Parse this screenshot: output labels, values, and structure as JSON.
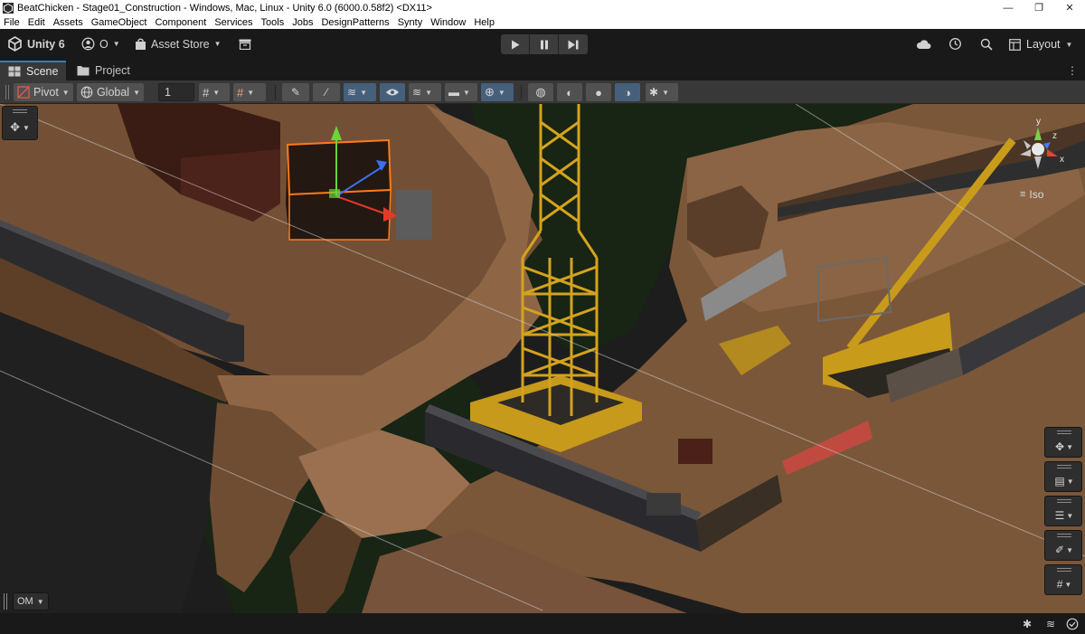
{
  "window": {
    "title": "BeatChicken - Stage01_Construction - Windows, Mac, Linux - Unity 6.0 (6000.0.58f2) <DX11>",
    "minimize": "—",
    "maximize": "❐",
    "close": "✕"
  },
  "menu": [
    "File",
    "Edit",
    "Assets",
    "GameObject",
    "Component",
    "Services",
    "Tools",
    "Jobs",
    "DesignPatterns",
    "Synty",
    "Window",
    "Help"
  ],
  "toolbar": {
    "product": "Unity 6",
    "account": "O",
    "asset_store": "Asset Store",
    "layout": "Layout"
  },
  "tabs": [
    {
      "label": "Scene",
      "active": true
    },
    {
      "label": "Project",
      "active": false
    }
  ],
  "scene_toolbar": {
    "pivot": "Pivot",
    "global": "Global",
    "grid_snap_value": "1"
  },
  "scene_view": {
    "projection": "Iso",
    "gizmo_axes": [
      "y",
      "z",
      "x"
    ],
    "overlay_menu": "OM"
  },
  "colors": {
    "accent": "#3a79bb",
    "ground": "#7a5638",
    "rock": "#9b7352",
    "crane": "#d4a31c",
    "selection": "#ff7a18"
  },
  "icons": {
    "unity_logo": "unity-logo-icon",
    "cloud": "cloud-icon",
    "history": "history-icon",
    "search": "search-icon"
  }
}
